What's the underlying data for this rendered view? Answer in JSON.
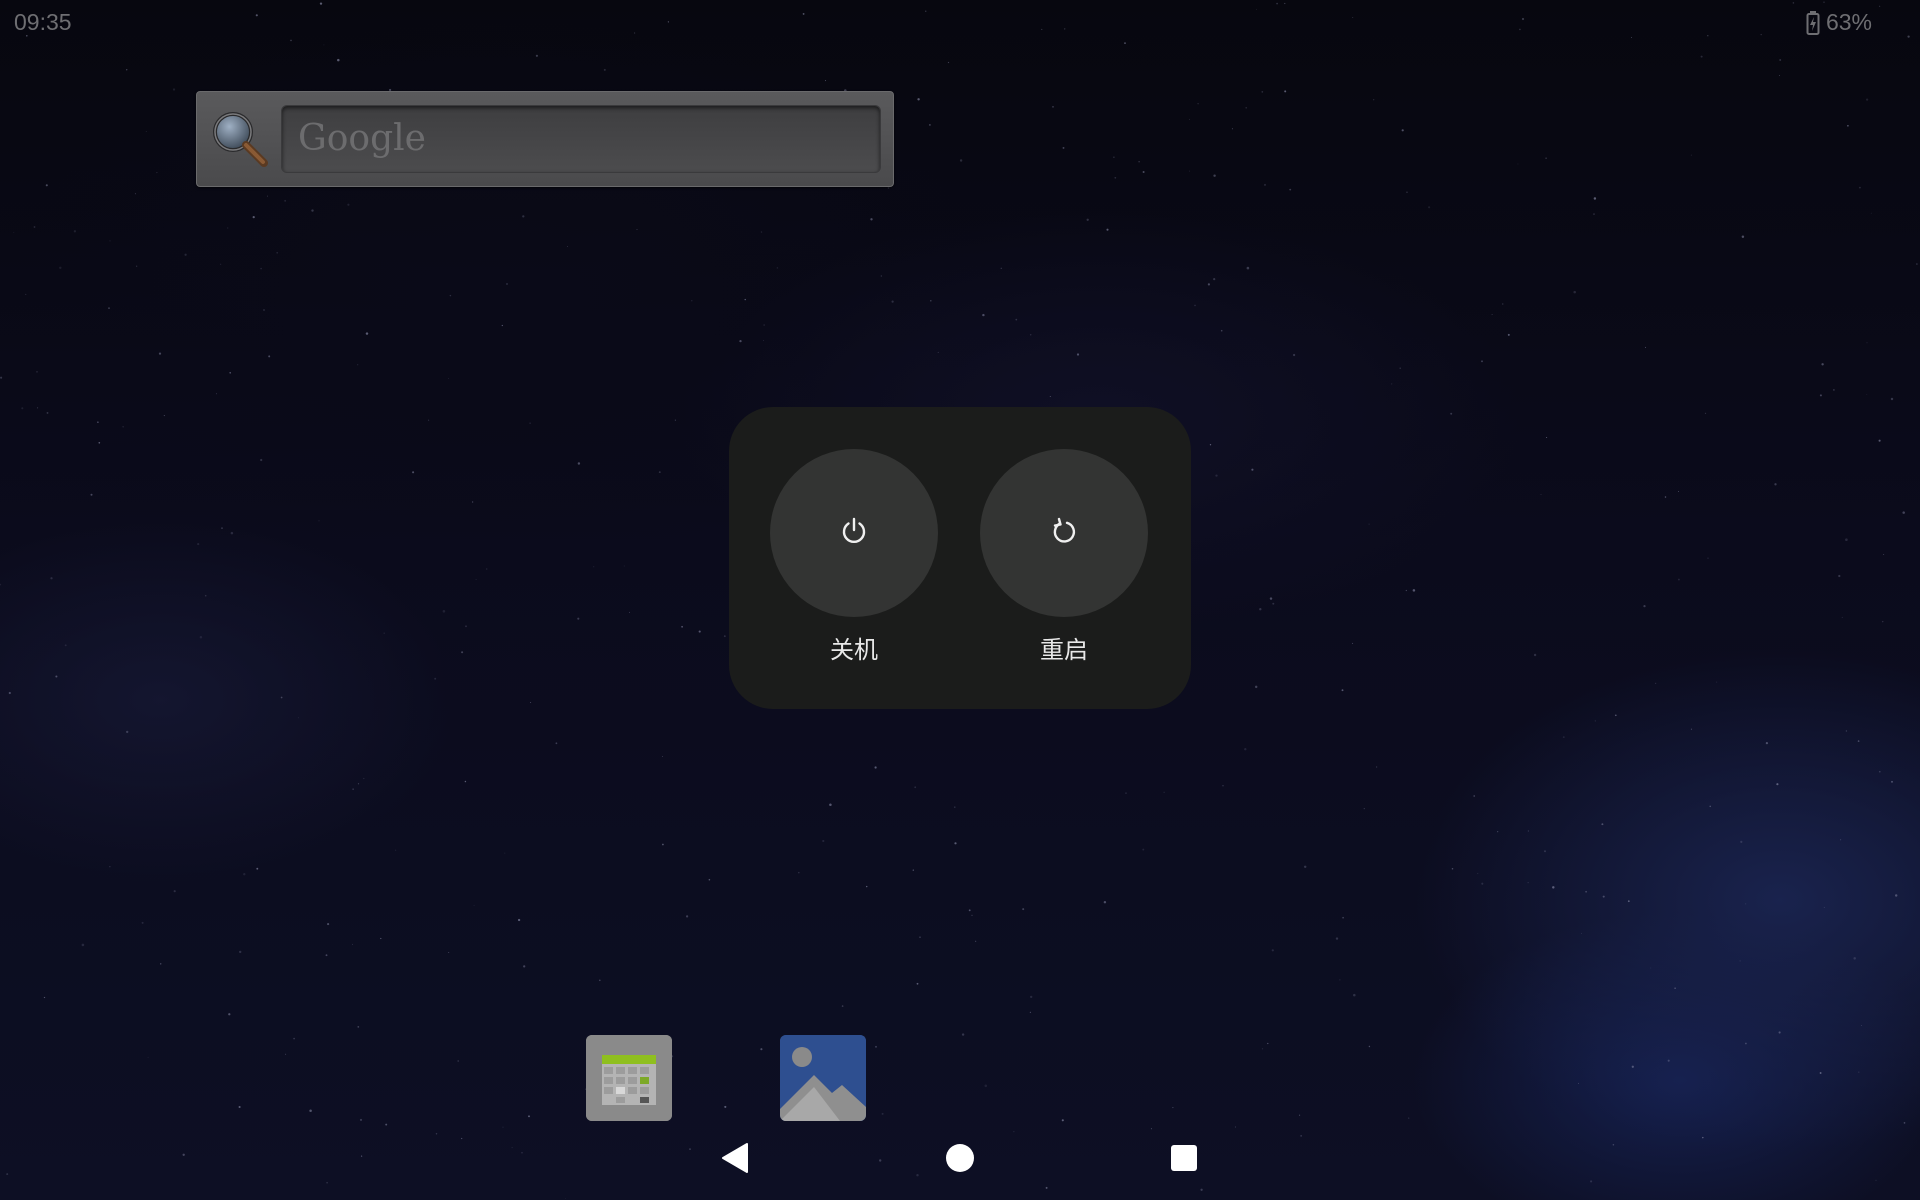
{
  "status_bar": {
    "time": "09:35",
    "battery_percent": "63%",
    "battery_icon": "battery-charging-icon"
  },
  "search_widget": {
    "placeholder": "Google",
    "icon": "magnifier-icon"
  },
  "power_menu": {
    "options": [
      {
        "label": "关机",
        "icon": "power-icon"
      },
      {
        "label": "重启",
        "icon": "restart-icon"
      }
    ]
  },
  "dock": {
    "apps": [
      {
        "icon": "calendar-app-icon"
      },
      {
        "icon": "gallery-app-icon"
      }
    ]
  },
  "nav_bar": {
    "buttons": [
      "back-icon",
      "home-icon",
      "recents-icon"
    ]
  },
  "colors": {
    "dialog_bg": "#1b1c1b",
    "button_bg": "#333433",
    "text": "#e8e8e8",
    "status_text": "#6e6e72"
  }
}
